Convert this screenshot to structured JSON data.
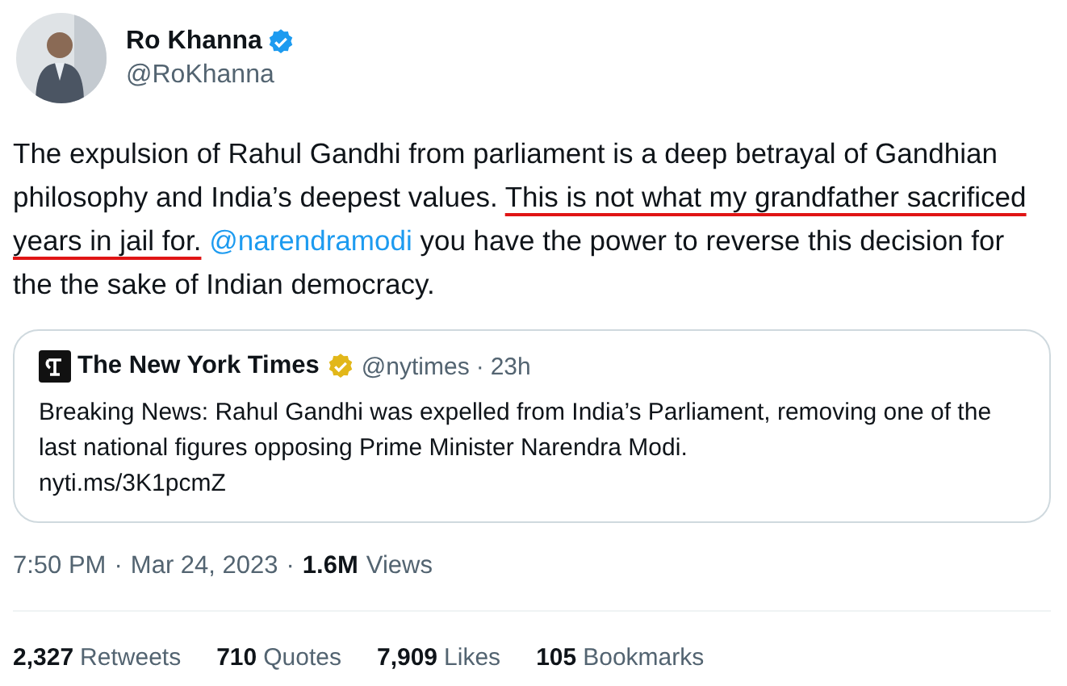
{
  "author": {
    "name": "Ro Khanna",
    "verified": true,
    "handle": "@RoKhanna"
  },
  "body": [
    {
      "kind": "plain",
      "text": "The expulsion of Rahul Gandhi from parliament is a deep betrayal of Gandhian philosophy and India’s deepest values. "
    },
    {
      "kind": "underlined",
      "text": "This is not what my grandfather sacrificed years in jail for."
    },
    {
      "kind": "mention",
      "text": "@narendramodi"
    },
    {
      "kind": "plain",
      "text": " you have the power to reverse this decision for the the sake of Indian democracy."
    }
  ],
  "quote": {
    "name": "The New York Times",
    "verified": true,
    "handle": "@nytimes",
    "separator": "·",
    "age": "23h",
    "text": "Breaking News: Rahul Gandhi was expelled from India’s Parliament, removing one of the last national figures opposing Prime Minister Narendra Modi.",
    "link": "nyti.ms/3K1pcmZ"
  },
  "meta": {
    "time": "7:50 PM",
    "separator": "·",
    "date": "Mar 24, 2023",
    "separator2": "·",
    "views_count": "1.6M",
    "views_label": "Views"
  },
  "stats": [
    {
      "count": "2,327",
      "label": "Retweets"
    },
    {
      "count": "710",
      "label": "Quotes"
    },
    {
      "count": "7,909",
      "label": "Likes"
    },
    {
      "count": "105",
      "label": "Bookmarks"
    }
  ]
}
